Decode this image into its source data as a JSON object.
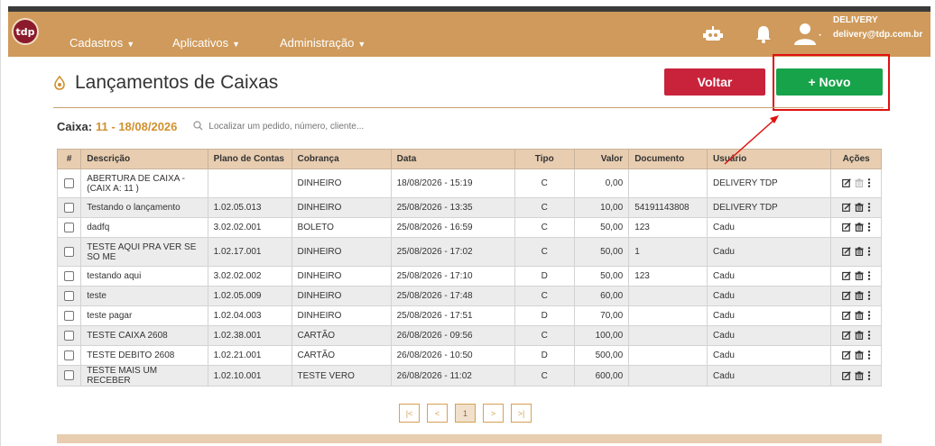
{
  "nav": {
    "logo_text": "tdp",
    "menus": [
      {
        "label": "Cadastros"
      },
      {
        "label": "Aplicativos"
      },
      {
        "label": "Administração"
      }
    ],
    "user_name": "DELIVERY",
    "user_email": "delivery@tdp.com.br"
  },
  "page": {
    "title": "Lançamentos de Caixas",
    "voltar_label": "Voltar",
    "novo_label": "+ Novo"
  },
  "caixa": {
    "label": "Caixa:",
    "value": "11 - 18/08/2026",
    "search_placeholder": "Localizar um pedido, número, cliente..."
  },
  "table": {
    "headers": [
      "#",
      "Descrição",
      "Plano de Contas",
      "Cobrança",
      "Data",
      "Tipo",
      "Valor",
      "Documento",
      "Usuário",
      "Ações"
    ],
    "rows": [
      {
        "descricao": "ABERTURA DE CAIXA - (CAIX A: 11 )",
        "plano": "",
        "cobranca": "DINHEIRO",
        "data": "18/08/2026 - 15:19",
        "tipo": "C",
        "valor": "0,00",
        "documento": "",
        "usuario": "DELIVERY TDP"
      },
      {
        "descricao": "Testando o lançamento",
        "plano": "1.02.05.013",
        "cobranca": "DINHEIRO",
        "data": "25/08/2026 - 13:35",
        "tipo": "C",
        "valor": "10,00",
        "documento": "54191143808",
        "usuario": "DELIVERY TDP"
      },
      {
        "descricao": "dadfq",
        "plano": "3.02.02.001",
        "cobranca": "BOLETO",
        "data": "25/08/2026 - 16:59",
        "tipo": "C",
        "valor": "50,00",
        "documento": "123",
        "usuario": "Cadu"
      },
      {
        "descricao": "TESTE AQUI PRA VER SE SO ME",
        "plano": "1.02.17.001",
        "cobranca": "DINHEIRO",
        "data": "25/08/2026 - 17:02",
        "tipo": "C",
        "valor": "50,00",
        "documento": "1",
        "usuario": "Cadu"
      },
      {
        "descricao": "testando aqui",
        "plano": "3.02.02.002",
        "cobranca": "DINHEIRO",
        "data": "25/08/2026 - 17:10",
        "tipo": "D",
        "valor": "50,00",
        "documento": "123",
        "usuario": "Cadu"
      },
      {
        "descricao": "teste",
        "plano": "1.02.05.009",
        "cobranca": "DINHEIRO",
        "data": "25/08/2026 - 17:48",
        "tipo": "C",
        "valor": "60,00",
        "documento": "",
        "usuario": "Cadu"
      },
      {
        "descricao": "teste pagar",
        "plano": "1.02.04.003",
        "cobranca": "DINHEIRO",
        "data": "25/08/2026 - 17:51",
        "tipo": "D",
        "valor": "70,00",
        "documento": "",
        "usuario": "Cadu"
      },
      {
        "descricao": "TESTE CAIXA 2608",
        "plano": "1.02.38.001",
        "cobranca": "CARTÃO",
        "data": "26/08/2026 - 09:56",
        "tipo": "C",
        "valor": "100,00",
        "documento": "",
        "usuario": "Cadu"
      },
      {
        "descricao": "TESTE DEBITO 2608",
        "plano": "1.02.21.001",
        "cobranca": "CARTÃO",
        "data": "26/08/2026 - 10:50",
        "tipo": "D",
        "valor": "500,00",
        "documento": "",
        "usuario": "Cadu"
      },
      {
        "descricao": "TESTE MAIS UM RECEBER",
        "plano": "1.02.10.001",
        "cobranca": "TESTE VERO",
        "data": "26/08/2026 - 11:02",
        "tipo": "C",
        "valor": "600,00",
        "documento": "",
        "usuario": "Cadu"
      }
    ]
  },
  "pager": {
    "first": "|<",
    "prev": "<",
    "current": "1",
    "next": ">",
    "last": ">|"
  },
  "colors": {
    "navbar": "#cf9a5b",
    "voltar": "#c8233b",
    "novo": "#17a34a",
    "accent": "#d0902f",
    "annotation": "#e01010"
  }
}
